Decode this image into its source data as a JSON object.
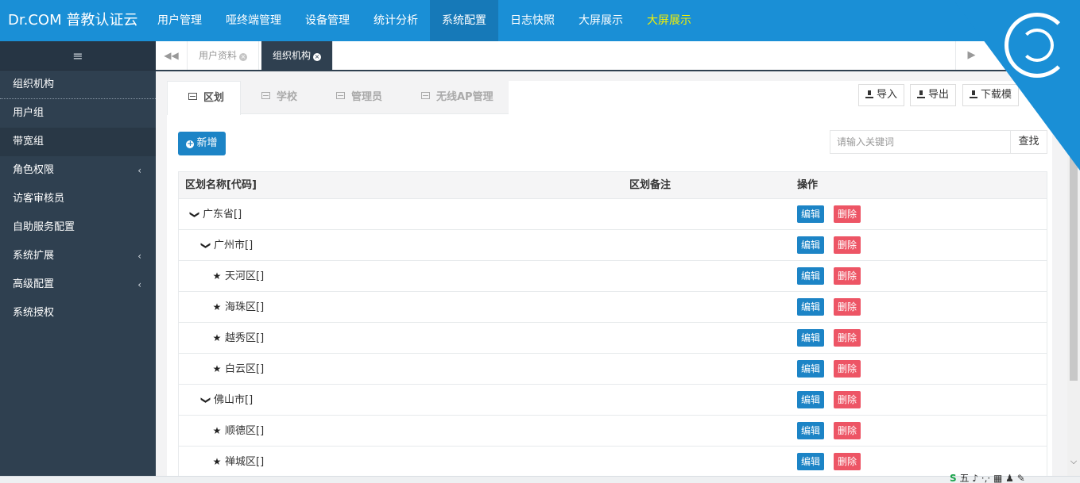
{
  "brand": {
    "title": "Dr.COM 普教认证云"
  },
  "topnav": [
    {
      "label": "用户管理"
    },
    {
      "label": "哑终端管理"
    },
    {
      "label": "设备管理"
    },
    {
      "label": "统计分析"
    },
    {
      "label": "系统配置",
      "active": true
    },
    {
      "label": "日志快照"
    },
    {
      "label": "大屏展示"
    },
    {
      "label": "大屏展示",
      "highlight": true
    }
  ],
  "sidebar": {
    "toggle_icon": "≡",
    "items": [
      {
        "label": "组织机构"
      },
      {
        "label": "用户组"
      },
      {
        "label": "带宽组"
      },
      {
        "label": "角色权限",
        "arrow": "‹"
      },
      {
        "label": "访客审核员"
      },
      {
        "label": "自助服务配置"
      },
      {
        "label": "系统扩展",
        "arrow": "‹"
      },
      {
        "label": "高级配置",
        "arrow": "‹"
      },
      {
        "label": "系统授权"
      }
    ]
  },
  "page_tabs": {
    "back_icon": "◀◀",
    "tabs": [
      {
        "label": "用户资料",
        "close": "×"
      },
      {
        "label": "组织机构",
        "close": "×",
        "active": true
      }
    ],
    "end_icon": "▶"
  },
  "subtabs": [
    {
      "label": "区划",
      "active": true
    },
    {
      "label": "学校"
    },
    {
      "label": "管理员"
    },
    {
      "label": "无线AP管理"
    }
  ],
  "tools": {
    "import_label": "导入",
    "export_label": "导出",
    "download_label": "下载模"
  },
  "new_button": {
    "label": "新增",
    "icon": "+"
  },
  "search": {
    "placeholder": "请输入关键词",
    "button_label": "查找"
  },
  "table": {
    "headers": {
      "name": "区划名称[代码]",
      "remark": "区划备注",
      "actions": "操作"
    },
    "edit_label": "编辑",
    "delete_label": "删除",
    "rows": [
      {
        "name": "广东省[]",
        "icon": "❯",
        "level": 0
      },
      {
        "name": "广州市[]",
        "icon": "❯",
        "level": 1
      },
      {
        "name": "天河区[]",
        "icon": "★",
        "level": 2
      },
      {
        "name": "海珠区[]",
        "icon": "★",
        "level": 2
      },
      {
        "name": "越秀区[]",
        "icon": "★",
        "level": 2
      },
      {
        "name": "白云区[]",
        "icon": "★",
        "level": 2
      },
      {
        "name": "佛山市[]",
        "icon": "❯",
        "level": 1
      },
      {
        "name": "顺德区[]",
        "icon": "★",
        "level": 2
      },
      {
        "name": "禅城区[]",
        "icon": "★",
        "level": 2
      }
    ]
  },
  "ime": {
    "s_label": "S",
    "text": "五 ♪ ·,· ▦ ♟ ✎"
  },
  "colors": {
    "header": "#1a8fd6",
    "sidebar": "#2f4050",
    "edit": "#1c84c6",
    "delete": "#ed5565"
  }
}
